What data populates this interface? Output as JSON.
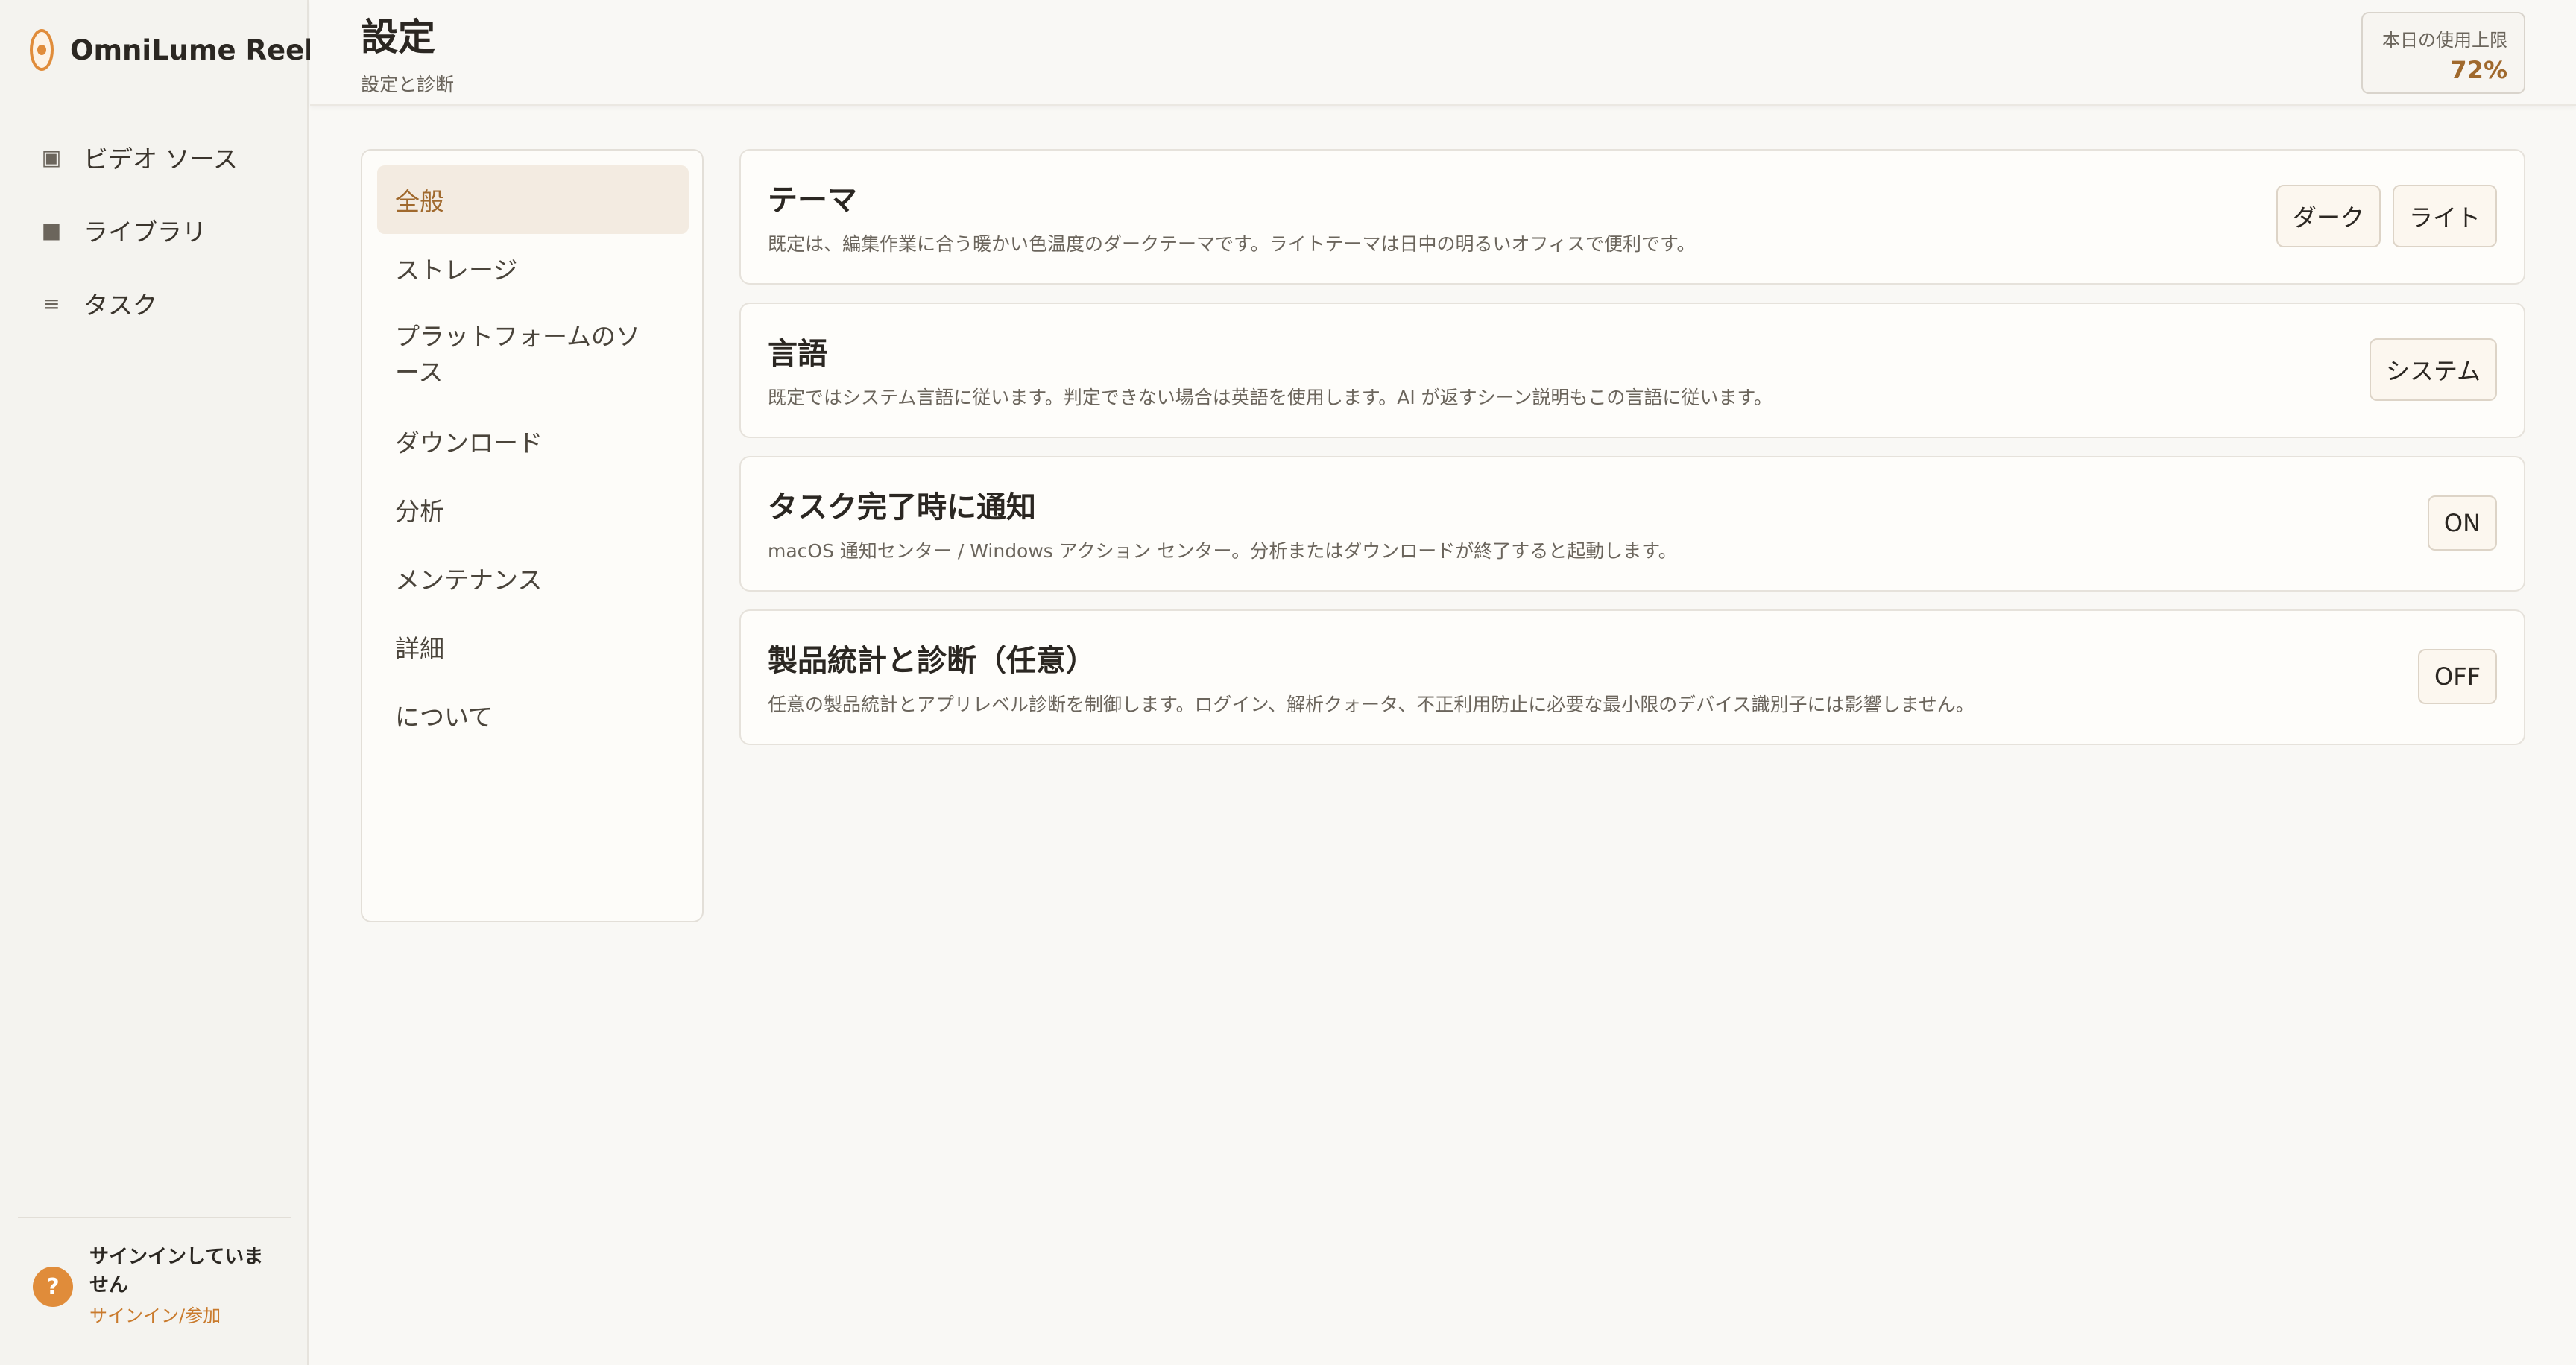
{
  "app": {
    "name": "OmniLume Reel"
  },
  "sidebar": {
    "items": [
      {
        "icon": "▣",
        "label": "ビデオ ソース"
      },
      {
        "icon": "■",
        "label": "ライブラリ"
      },
      {
        "icon": "≡",
        "label": "タスク"
      }
    ]
  },
  "user": {
    "avatar": "?",
    "status": "サインインしていません",
    "action": "サインイン/参加"
  },
  "header": {
    "title": "設定",
    "subtitle": "設定と診断",
    "usage_label": "本日の使用上限",
    "usage_value": "72%"
  },
  "categories": [
    "全般",
    "ストレージ",
    "プラットフォームのソース",
    "ダウンロード",
    "分析",
    "メンテナンス",
    "詳細",
    "について"
  ],
  "active_category": "全般",
  "settings": [
    {
      "title": "テーマ",
      "description": "既定は、編集作業に合う暖かい色温度のダークテーマです。ライトテーマは日中の明るいオフィスで便利です。",
      "buttons": [
        "ダーク",
        "ライト"
      ]
    },
    {
      "title": "言語",
      "description": "既定ではシステム言語に従います。判定できない場合は英語を使用します。AI が返すシーン説明もこの言語に従います。",
      "buttons": [
        "システム"
      ]
    },
    {
      "title": "タスク完了時に通知",
      "description": "macOS 通知センター / Windows アクション センター。分析またはダウンロードが終了すると起動します。",
      "buttons": [
        "ON"
      ]
    },
    {
      "title": "製品統計と診断（任意）",
      "description": "任意の製品統計とアプリレベル診断を制御します。ログイン、解析クォータ、不正利用防止に必要な最小限のデバイス識別子には影響しません。",
      "buttons": [
        "OFF"
      ]
    }
  ],
  "colors": {
    "accent": "#e08c3a",
    "accent_text": "#a0692d",
    "link": "#c97a2c",
    "sidebar_bg": "#f4f3ef",
    "page_bg": "#f9f8f5"
  }
}
